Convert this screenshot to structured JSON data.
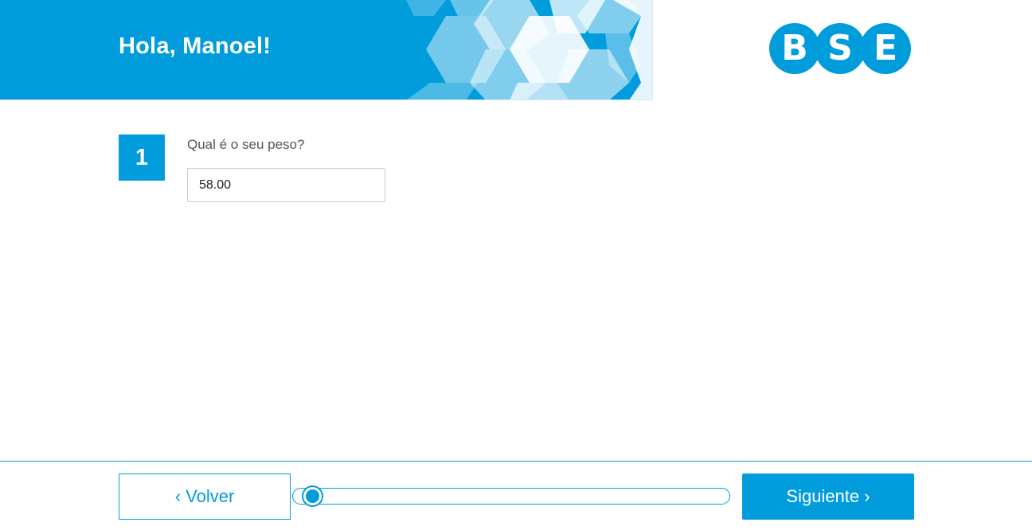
{
  "header": {
    "greeting": "Hola, Manoel!",
    "logo": {
      "letters": [
        "B",
        "S",
        "E"
      ]
    }
  },
  "question": {
    "number": "1",
    "label": "Qual é o seu peso?",
    "value": "58.00",
    "placeholder": ""
  },
  "navigation": {
    "back_label": "‹ Volver",
    "next_label": "Siguiente ›",
    "progress": 0.025
  },
  "colors": {
    "brand": "#009cdc",
    "text": "#555555",
    "background": "#ffffff"
  }
}
